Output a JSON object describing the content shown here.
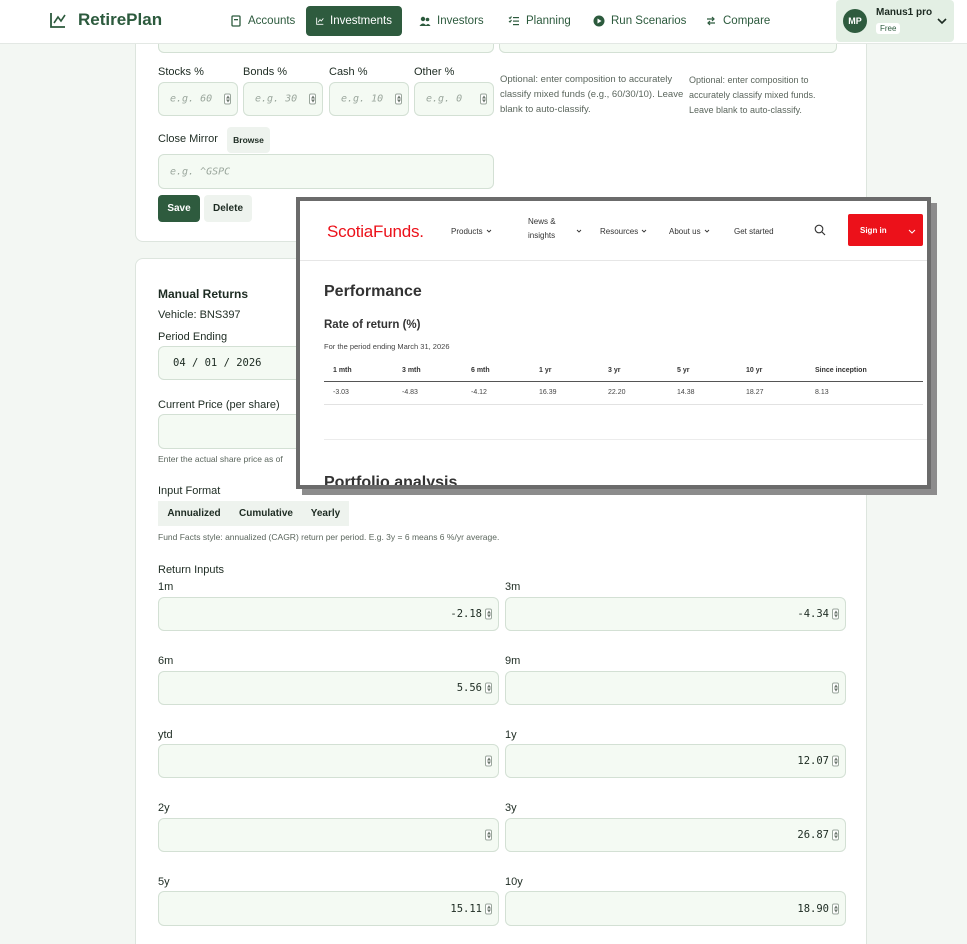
{
  "app": {
    "brand": "RetirePlan",
    "nav": [
      "Accounts",
      "Investments",
      "Investors",
      "Planning",
      "Run Scenarios",
      "Compare"
    ],
    "active_nav": "Investments",
    "user": {
      "initials": "MP",
      "name": "Manus1 pro",
      "plan": "Free"
    }
  },
  "composition": {
    "fields": [
      {
        "label": "Stocks %",
        "placeholder": "e.g. 60"
      },
      {
        "label": "Bonds %",
        "placeholder": "e.g. 30"
      },
      {
        "label": "Cash %",
        "placeholder": "e.g. 10"
      },
      {
        "label": "Other %",
        "placeholder": "e.g. 0"
      }
    ],
    "hint": "Optional: enter composition to accurately classify mixed funds (e.g., 60/30/10). Leave blank to auto-classify.",
    "hint_right": "Optional: enter composition to accurately classify mixed funds. Leave blank to auto-classify.",
    "close_mirror_label": "Close Mirror",
    "browse_label": "Browse",
    "close_mirror_placeholder": "e.g. ^GSPC",
    "save_label": "Save",
    "delete_label": "Delete"
  },
  "manual_returns": {
    "title": "Manual Returns",
    "vehicle": "Vehicle: BNS397",
    "period_ending_label": "Period Ending",
    "period_ending_value": "04 / 01 / 2026",
    "current_price_label": "Current Price (per share)",
    "current_price_hint": "Enter the actual share price as of",
    "input_format_label": "Input Format",
    "formats": [
      "Annualized",
      "Cumulative",
      "Yearly"
    ],
    "format_hint": "Fund Facts style: annualized (CAGR) return per period. E.g. 3y = 6 means 6 %/yr average.",
    "return_inputs_label": "Return Inputs",
    "returns": [
      {
        "label": "1m",
        "value": "-2.18"
      },
      {
        "label": "3m",
        "value": "-4.34"
      },
      {
        "label": "6m",
        "value": "5.56"
      },
      {
        "label": "9m",
        "value": ""
      },
      {
        "label": "ytd",
        "value": ""
      },
      {
        "label": "1y",
        "value": "12.07"
      },
      {
        "label": "2y",
        "value": ""
      },
      {
        "label": "3y",
        "value": "26.87"
      },
      {
        "label": "5y",
        "value": "15.11"
      },
      {
        "label": "10y",
        "value": "18.90"
      }
    ]
  },
  "overlay": {
    "logo": "ScotiaFunds.",
    "nav": [
      "Products",
      "News &",
      "insights",
      "Resources",
      "About us",
      "Get started"
    ],
    "sign_in": "Sign in",
    "section_title": "Performance",
    "subtitle": "Rate of return (%)",
    "period": "For the period ending March 31, 2026",
    "headers": [
      "1 mth",
      "3 mth",
      "6 mth",
      "1 yr",
      "3 yr",
      "5 yr",
      "10 yr",
      "Since inception"
    ],
    "values": [
      "-3.03",
      "-4.83",
      "-4.12",
      "16.39",
      "22.20",
      "14.38",
      "18.27",
      "8.13"
    ],
    "next_section": "Portfolio analysis"
  },
  "colors": {
    "brand_green": "#2e5b3e",
    "field_bg": "#f4faf3",
    "scotia_red": "#ec111a"
  }
}
